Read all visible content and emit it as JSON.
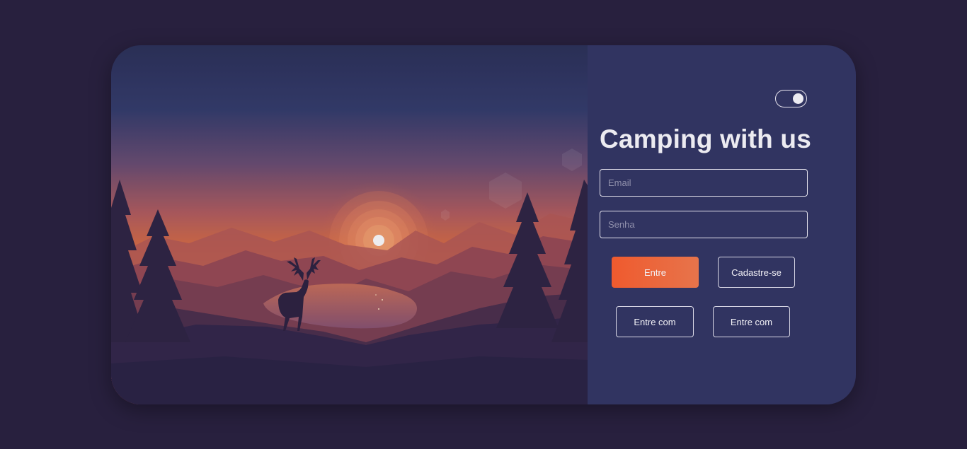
{
  "header": {
    "title": "Camping with us"
  },
  "theme_toggle": {
    "state": "on"
  },
  "form": {
    "email_placeholder": "Email",
    "password_placeholder": "Senha",
    "login_label": "Entre",
    "signup_label": "Cadastre-se",
    "social_login_1_label": "Entre com",
    "social_login_2_label": "Entre com"
  },
  "colors": {
    "background": "#28203e",
    "panel": "#313461",
    "accent": "#ef5a2e",
    "text": "#ecebf1"
  },
  "illustration": {
    "subject": "deer-at-sunset-lake"
  }
}
